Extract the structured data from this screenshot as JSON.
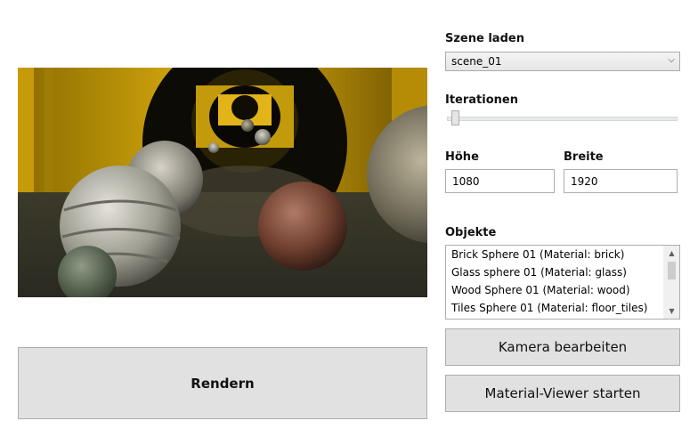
{
  "scene": {
    "label": "Szene laden",
    "selected": "scene_01"
  },
  "iterations": {
    "label": "Iterationen",
    "value_fraction": 0.02
  },
  "height": {
    "label": "Höhe",
    "value": "1080"
  },
  "width": {
    "label": "Breite",
    "value": "1920"
  },
  "objects": {
    "label": "Objekte",
    "items": [
      "Brick Sphere 01 (Material: brick)",
      "Glass sphere 01 (Material: glass)",
      "Wood Sphere 01 (Material: wood)",
      "Tiles Sphere 01 (Material: floor_tiles)"
    ]
  },
  "buttons": {
    "render": "Rendern",
    "camera": "Kamera bearbeiten",
    "material_viewer": "Material-Viewer starten"
  },
  "icons": {
    "dropdown": "chevron-down-icon",
    "scroll_up": "arrow-up-icon",
    "scroll_down": "arrow-down-icon"
  }
}
